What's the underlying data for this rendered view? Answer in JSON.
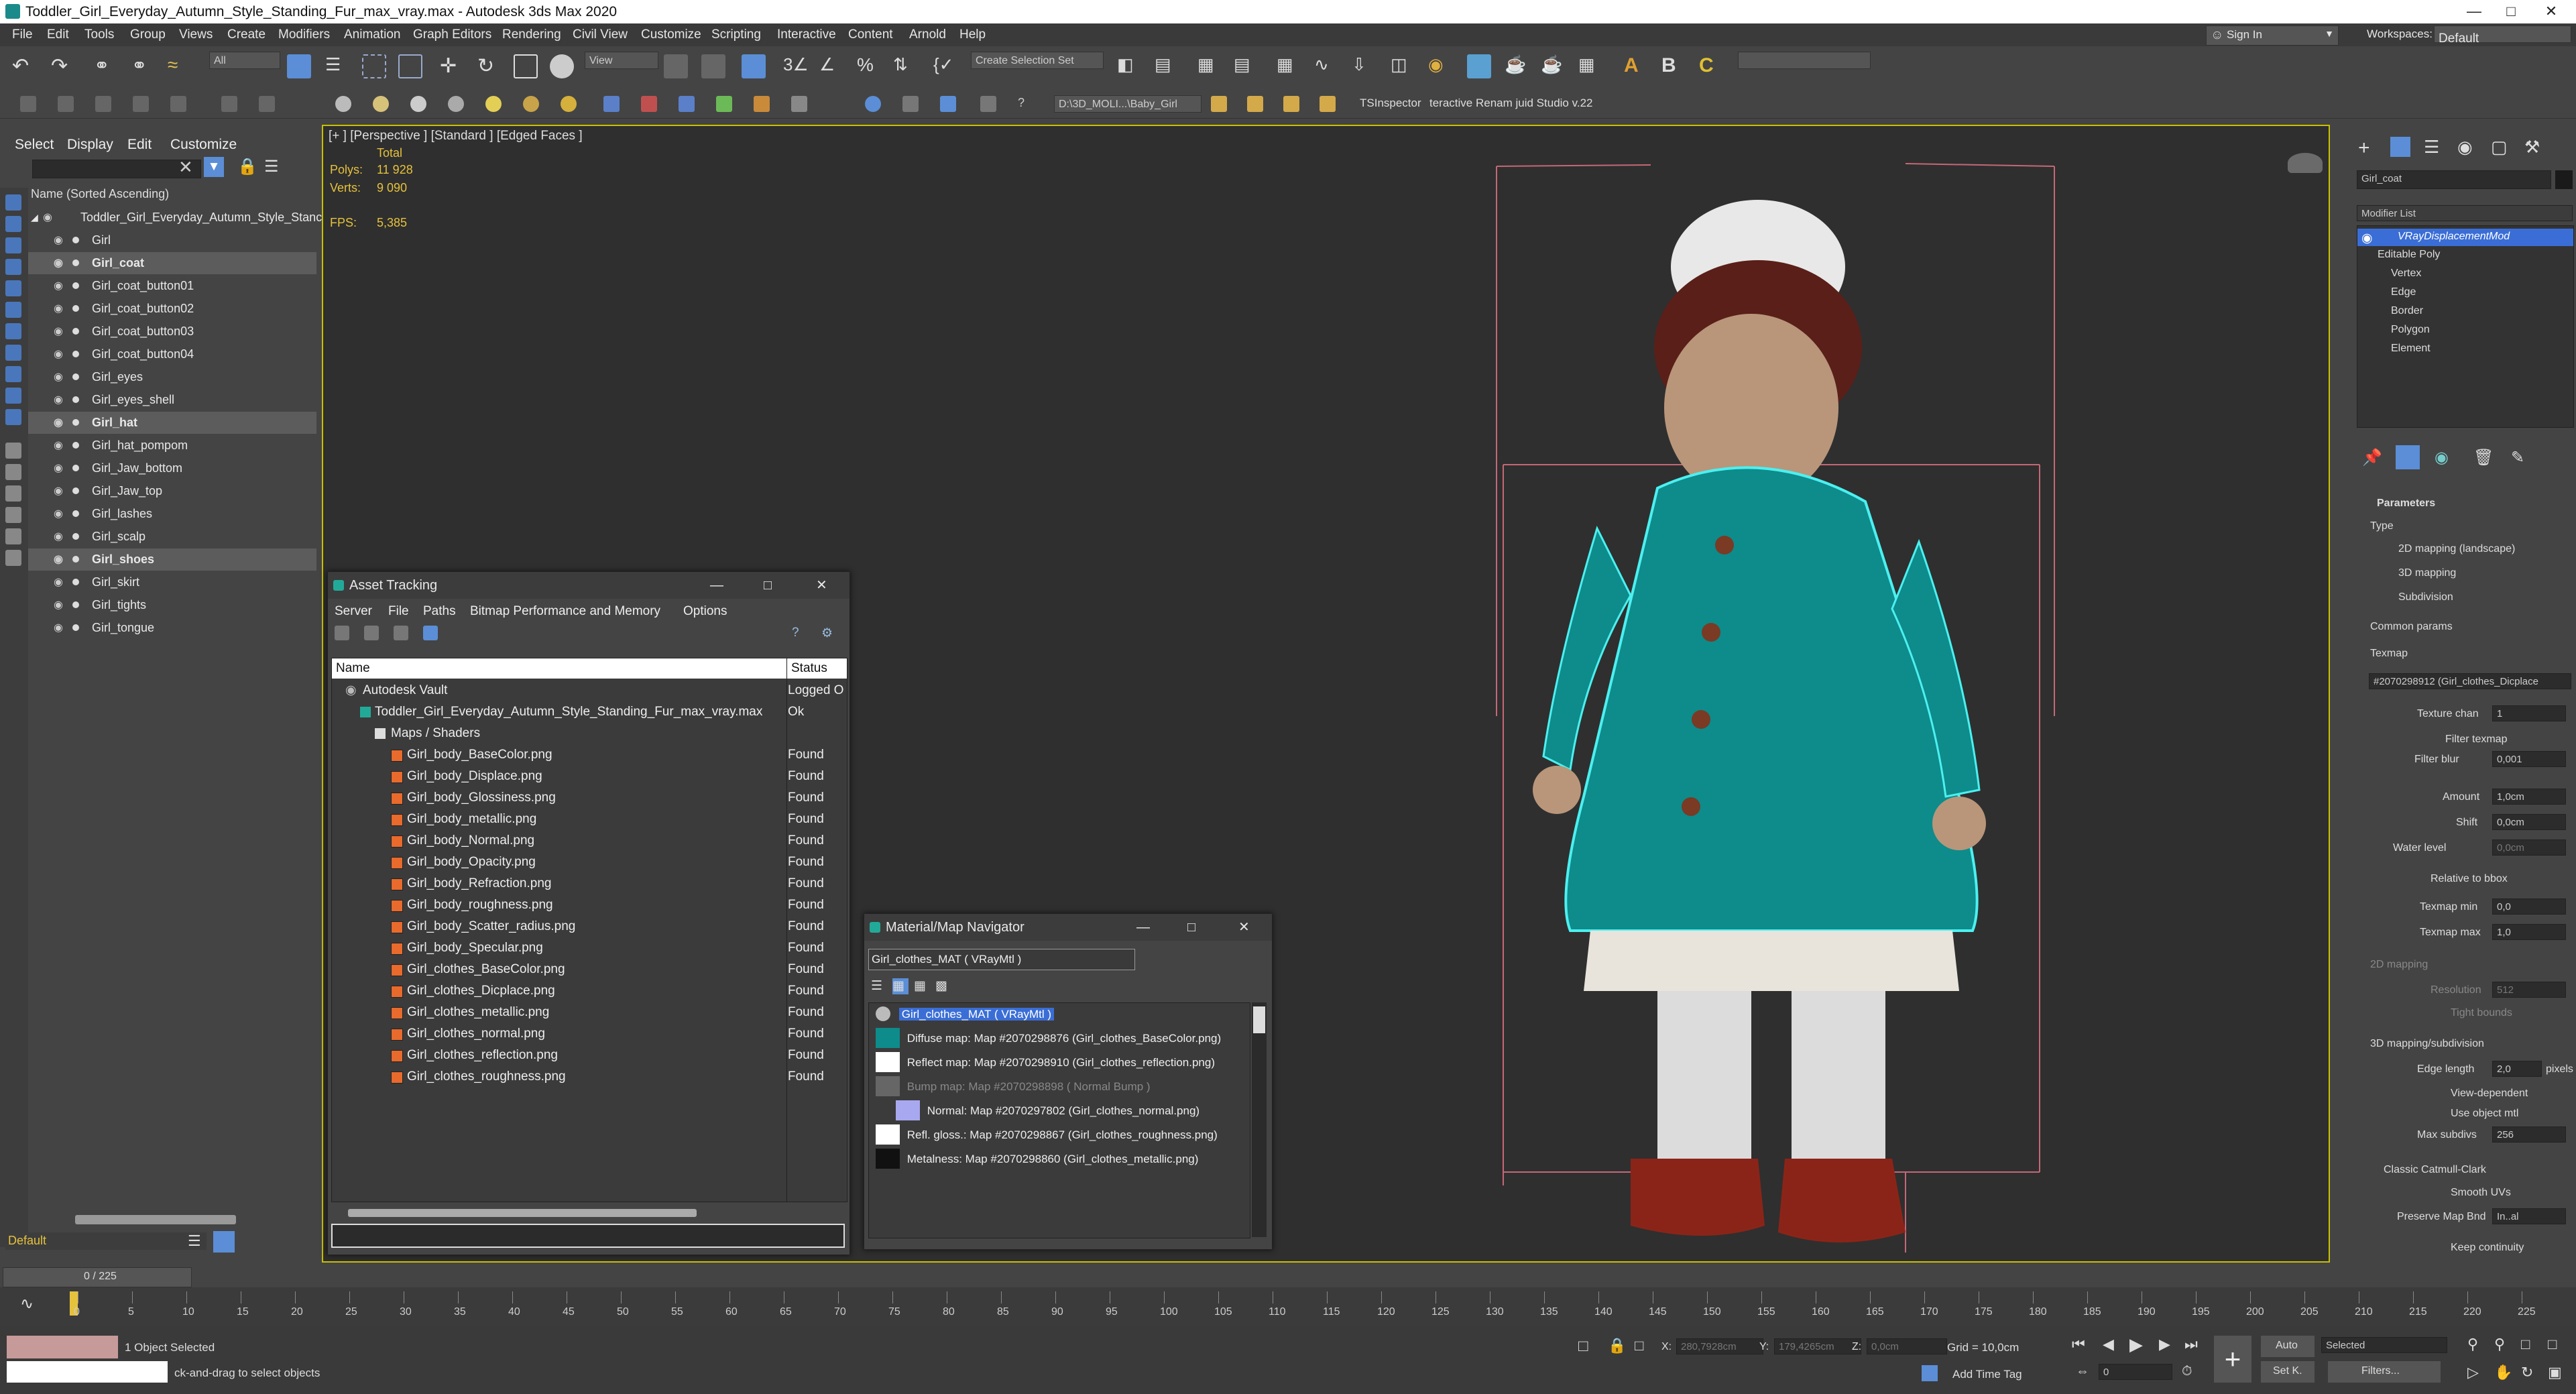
{
  "window": {
    "title": "Toddler_Girl_Everyday_Autumn_Style_Standing_Fur_max_vray.max - Autodesk 3ds Max 2020"
  },
  "menu": [
    "File",
    "Edit",
    "Tools",
    "Group",
    "Views",
    "Create",
    "Modifiers",
    "Animation",
    "Graph Editors",
    "Rendering",
    "Civil View",
    "Customize",
    "Scripting",
    "Interactive",
    "Content",
    "Arnold",
    "Help"
  ],
  "topright": {
    "signin": "Sign In",
    "workspaces_label": "Workspaces:",
    "workspace": "Default"
  },
  "toolbar": {
    "filter": "All",
    "view": "View",
    "selection_set": "Create Selection Set",
    "path": "D:\\3D_MOLI...\\Baby_Girl",
    "ts_inspector": "TSInspector",
    "renamer": "teractive Renam juid Studio v.22"
  },
  "scene": {
    "tabs": [
      "Select",
      "Display",
      "Edit",
      "Customize"
    ],
    "header": "Name (Sorted Ascending)",
    "root": "Toddler_Girl_Everyday_Autumn_Style_Stanc",
    "items": [
      {
        "name": "Girl",
        "bold": false
      },
      {
        "name": "Girl_coat",
        "bold": true
      },
      {
        "name": "Girl_coat_button01",
        "bold": false
      },
      {
        "name": "Girl_coat_button02",
        "bold": false
      },
      {
        "name": "Girl_coat_button03",
        "bold": false
      },
      {
        "name": "Girl_coat_button04",
        "bold": false
      },
      {
        "name": "Girl_eyes",
        "bold": false
      },
      {
        "name": "Girl_eyes_shell",
        "bold": false
      },
      {
        "name": "Girl_hat",
        "bold": true
      },
      {
        "name": "Girl_hat_pompom",
        "bold": false
      },
      {
        "name": "Girl_Jaw_bottom",
        "bold": false
      },
      {
        "name": "Girl_Jaw_top",
        "bold": false
      },
      {
        "name": "Girl_lashes",
        "bold": false
      },
      {
        "name": "Girl_scalp",
        "bold": false
      },
      {
        "name": "Girl_shoes",
        "bold": true
      },
      {
        "name": "Girl_skirt",
        "bold": false
      },
      {
        "name": "Girl_tights",
        "bold": false
      },
      {
        "name": "Girl_tongue",
        "bold": false
      }
    ],
    "layer": "Default"
  },
  "viewport": {
    "label": "[+ ] [Perspective ] [Standard ] [Edged Faces ]",
    "total": "Total",
    "polys_label": "Polys:",
    "polys": "11 928",
    "verts_label": "Verts:",
    "verts": "9 090",
    "fps_label": "FPS:",
    "fps": "5,385"
  },
  "asset": {
    "title": "Asset Tracking",
    "menu": [
      "Server",
      "File",
      "Paths",
      "Bitmap Performance and Memory",
      "Options"
    ],
    "col_name": "Name",
    "col_status": "Status",
    "vault": "Autodesk Vault",
    "vault_status": "Logged O",
    "file": "Toddler_Girl_Everyday_Autumn_Style_Standing_Fur_max_vray.max",
    "file_status": "Ok",
    "maps_group": "Maps / Shaders",
    "maps": [
      "Girl_body_BaseColor.png",
      "Girl_body_Displace.png",
      "Girl_body_Glossiness.png",
      "Girl_body_metallic.png",
      "Girl_body_Normal.png",
      "Girl_body_Opacity.png",
      "Girl_body_Refraction.png",
      "Girl_body_roughness.png",
      "Girl_body_Scatter_radius.png",
      "Girl_body_Specular.png",
      "Girl_clothes_BaseColor.png",
      "Girl_clothes_Dicplace.png",
      "Girl_clothes_metallic.png",
      "Girl_clothes_normal.png",
      "Girl_clothes_reflection.png",
      "Girl_clothes_roughness.png"
    ],
    "found": "Found"
  },
  "matnav": {
    "title": "Material/Map Navigator",
    "field": "Girl_clothes_MAT  ( VRayMtl )",
    "root": "Girl_clothes_MAT  ( VRayMtl )",
    "rows": [
      "Diffuse map: Map #2070298876 (Girl_clothes_BaseColor.png)",
      "Reflect map: Map #2070298910 (Girl_clothes_reflection.png)",
      "Bump map: Map #2070298898  ( Normal Bump )",
      "Normal: Map #2070297802 (Girl_clothes_normal.png)",
      "Refl. gloss.: Map #2070298867 (Girl_clothes_roughness.png)",
      "Metalness: Map #2070298860 (Girl_clothes_metallic.png)"
    ]
  },
  "cmd": {
    "object": "Girl_coat",
    "modifier_list": "Modifier List",
    "stack": [
      "VRayDisplacementMod",
      "Editable Poly",
      "Vertex",
      "Edge",
      "Border",
      "Polygon",
      "Element"
    ],
    "params": "Parameters",
    "type": "Type",
    "m2d": "2D mapping (landscape)",
    "m3d": "3D mapping",
    "msub": "Subdivision",
    "common": "Common params",
    "texmap": "Texmap",
    "texmap_val": "#2070298912 (Girl_clothes_Dicplace",
    "texture_chan": "Texture chan",
    "texture_chan_val": "1",
    "filter_texmap": "Filter texmap",
    "filter_blur": "Filter blur",
    "filter_blur_val": "0,001",
    "amount": "Amount",
    "amount_val": "1,0cm",
    "shift": "Shift",
    "shift_val": "0,0cm",
    "water": "Water level",
    "water_val": "0,0cm",
    "rel_bbox": "Relative to bbox",
    "tex_min": "Texmap min",
    "tex_min_val": "0,0",
    "tex_max": "Texmap max",
    "tex_max_val": "1,0",
    "m2d_head": "2D mapping",
    "resolution": "Resolution",
    "resolution_val": "512",
    "tight": "Tight bounds",
    "m3d_head": "3D mapping/subdivision",
    "edge_len": "Edge length",
    "edge_len_val": "2,0",
    "pixels": "pixels",
    "view_dep": "View-dependent",
    "use_obj": "Use object mtl",
    "max_subdivs": "Max subdivs",
    "max_subdivs_val": "256",
    "catmull": "Classic Catmull-Clark",
    "smooth_uv": "Smooth UVs",
    "preserve": "Preserve Map Bnd",
    "preserve_val": "In..al",
    "keep": "Keep continuity"
  },
  "timeline": {
    "frame": "0 / 225",
    "ticks": [
      "0",
      "5",
      "10",
      "15",
      "20",
      "25",
      "30",
      "35",
      "40",
      "45",
      "50",
      "55",
      "60",
      "65",
      "70",
      "75",
      "80",
      "85",
      "90",
      "95",
      "100",
      "105",
      "110",
      "115",
      "120",
      "125",
      "130",
      "135",
      "140",
      "145",
      "150",
      "155",
      "160",
      "165",
      "170",
      "175",
      "180",
      "185",
      "190",
      "195",
      "200",
      "205",
      "210",
      "215",
      "220",
      "225"
    ]
  },
  "status": {
    "selected": "1 Object Selected",
    "hint": "ck-and-drag to select objects",
    "x_label": "X:",
    "x": "280,7928cm",
    "y_label": "Y:",
    "y": "179,4265cm",
    "z_label": "Z:",
    "z": "0,0cm",
    "grid": "Grid = 10,0cm",
    "add_time_tag": "Add Time Tag",
    "auto": "Auto",
    "setk": "Set K.",
    "sel": "Selected",
    "filters": "Filters...",
    "frame_val": "0"
  }
}
